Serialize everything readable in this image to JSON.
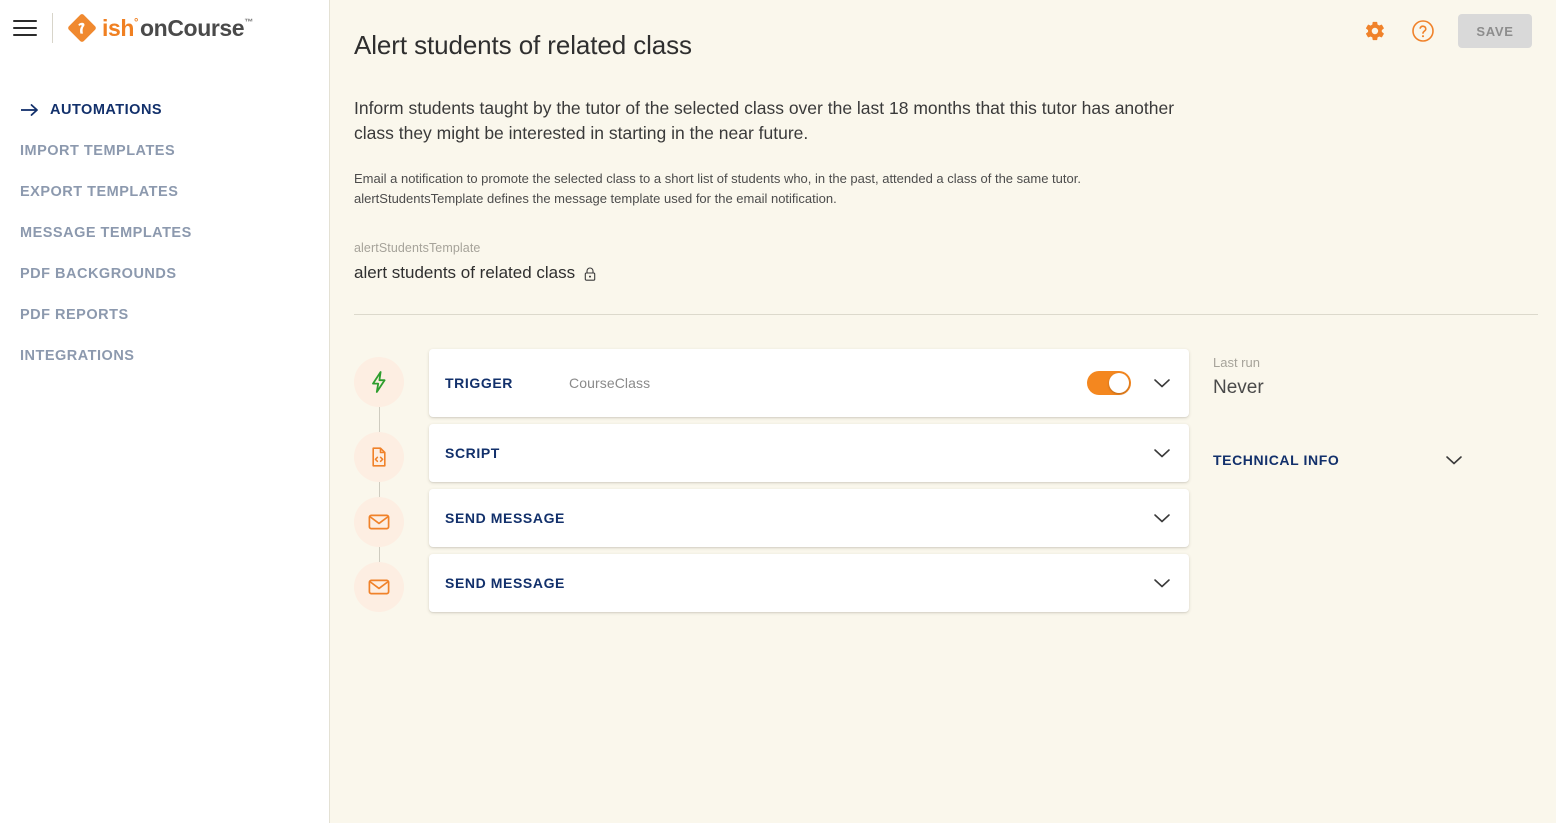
{
  "brand": {
    "logo_ish": "ish",
    "logo_degree": "°",
    "logo_oncourse": "onCourse",
    "logo_tm": "™",
    "accent_orange": "#F08022",
    "navy": "#12306B",
    "page_bg": "#FAF7EC",
    "sidebar_bg": "#FFFFFF",
    "bubble_bg": "#FDEEE2",
    "green": "#2E9E2E"
  },
  "sidebar": {
    "menu_icon": "hamburger-icon",
    "items": [
      {
        "label": "AUTOMATIONS",
        "active": true,
        "icon": "arrow-right-icon"
      },
      {
        "label": "IMPORT TEMPLATES",
        "active": false
      },
      {
        "label": "EXPORT TEMPLATES",
        "active": false
      },
      {
        "label": "MESSAGE TEMPLATES",
        "active": false
      },
      {
        "label": "PDF BACKGROUNDS",
        "active": false
      },
      {
        "label": "PDF REPORTS",
        "active": false
      },
      {
        "label": "INTEGRATIONS",
        "active": false
      }
    ]
  },
  "topbar": {
    "settings_icon": "gear-icon",
    "help_icon": "help-circle-icon",
    "save_label": "SAVE"
  },
  "page": {
    "title": "Alert students of related class",
    "lead": "Inform students taught by the tutor of the selected class over the last 18 months that this tutor has another class they might be interested in starting in the near future.",
    "sub_line_1": "Email a notification to promote the selected class to a short list of students who, in the past, attended a class of the same tutor.",
    "sub_line_2": "alertStudentsTemplate defines the message template used for the email notification.",
    "field_label": "alertStudentsTemplate",
    "field_value": "alert students of related class",
    "field_lock_icon": "lock-icon"
  },
  "workflow": {
    "steps": [
      {
        "icon": "lightning-bolt-icon",
        "title": "TRIGGER",
        "subtitle": "CourseClass",
        "has_toggle": true,
        "toggle_on": true,
        "chevron": "chevron-down-icon"
      },
      {
        "icon": "script-file-icon",
        "title": "SCRIPT",
        "subtitle": "",
        "has_toggle": false,
        "chevron": "chevron-down-icon"
      },
      {
        "icon": "envelope-icon",
        "title": "SEND MESSAGE",
        "subtitle": "",
        "has_toggle": false,
        "chevron": "chevron-down-icon"
      },
      {
        "icon": "envelope-icon",
        "title": "SEND MESSAGE",
        "subtitle": "",
        "has_toggle": false,
        "chevron": "chevron-down-icon"
      }
    ]
  },
  "right_panel": {
    "last_run_label": "Last run",
    "last_run_value": "Never",
    "technical_info_label": "TECHNICAL INFO",
    "technical_info_chevron": "chevron-down-icon"
  }
}
